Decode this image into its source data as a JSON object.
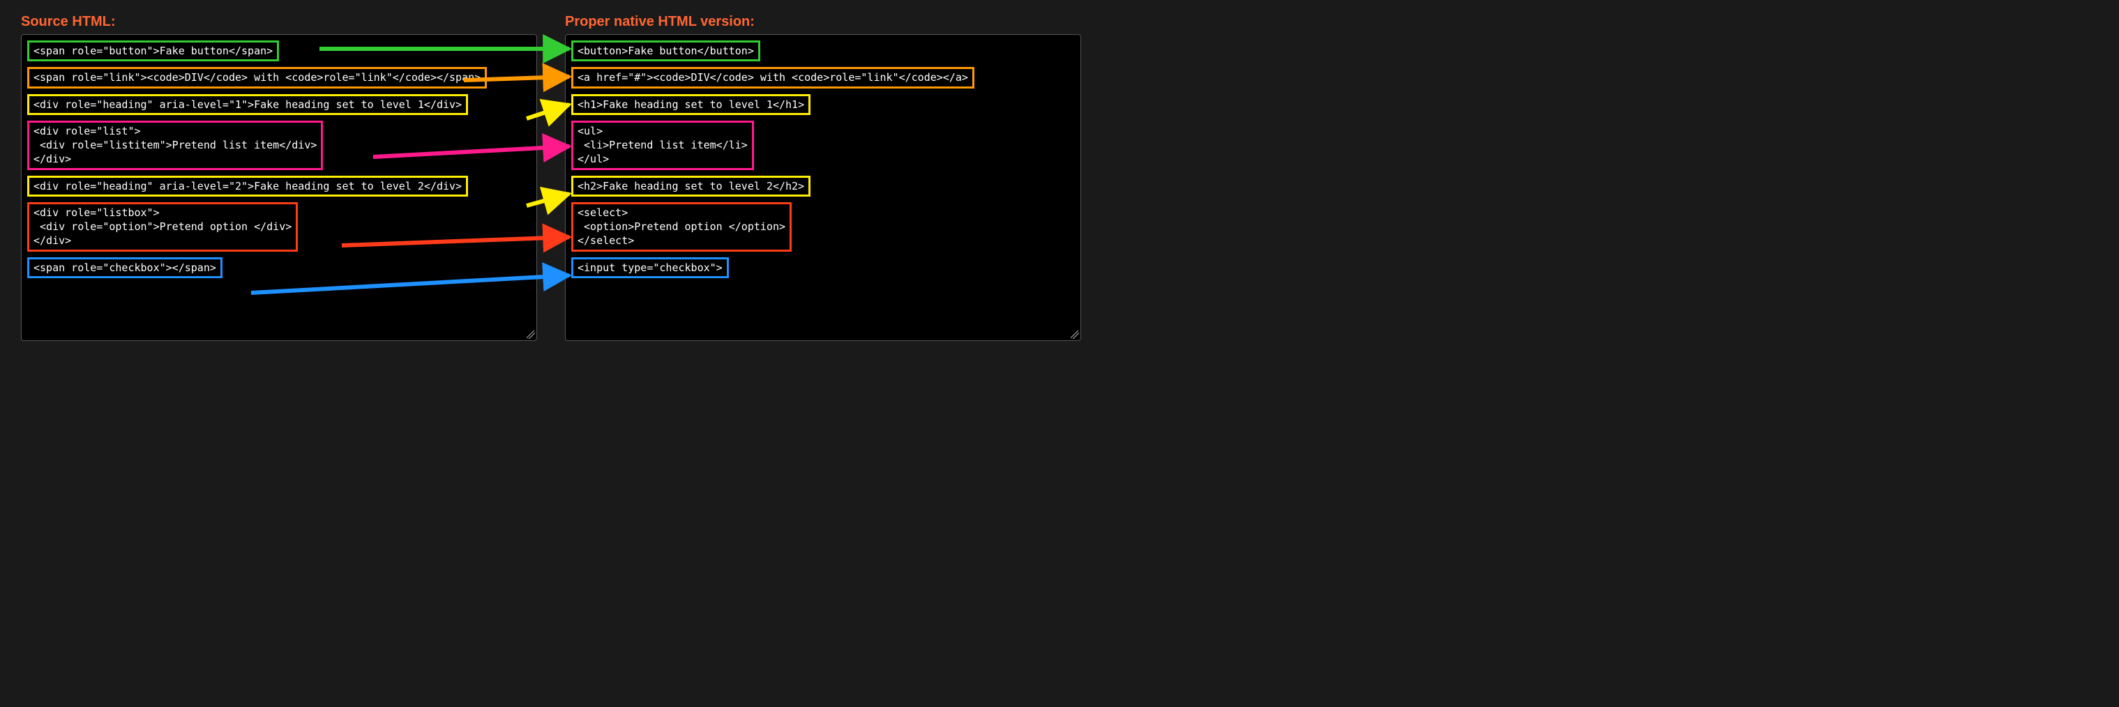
{
  "headers": {
    "left": "Source HTML:",
    "right": "Proper native HTML version:"
  },
  "left": {
    "button": "<span role=\"button\">Fake button</span>",
    "link": "<span role=\"link\"><code>DIV</code> with <code>role=\"link\"</code></span>",
    "heading1": "<div role=\"heading\" aria-level=\"1\">Fake heading set to level 1</div>",
    "list": "<div role=\"list\">\n <div role=\"listitem\">Pretend list item</div>\n</div>",
    "heading2": "<div role=\"heading\" aria-level=\"2\">Fake heading set to level 2</div>",
    "listbox": "<div role=\"listbox\">\n <div role=\"option\">Pretend option </div>\n</div>",
    "checkbox": "<span role=\"checkbox\"></span>"
  },
  "right": {
    "button": "<button>Fake button</button>",
    "link": "<a href=\"#\"><code>DIV</code> with <code>role=\"link\"</code></a>",
    "heading1": "<h1>Fake heading set to level 1</h1>",
    "list": "<ul>\n <li>Pretend list item</li>\n</ul>",
    "heading2": "<h2>Fake heading set to level 2</h2>",
    "listbox": "<select>\n <option>Pretend option </option>\n</select>",
    "checkbox": "<input type=\"checkbox\">"
  },
  "colors": {
    "green": "#33cc33",
    "orange": "#ff9900",
    "yellow": "#ffee00",
    "pink": "#ff1a8c",
    "red": "#ff3b1a",
    "blue": "#1e90ff"
  }
}
